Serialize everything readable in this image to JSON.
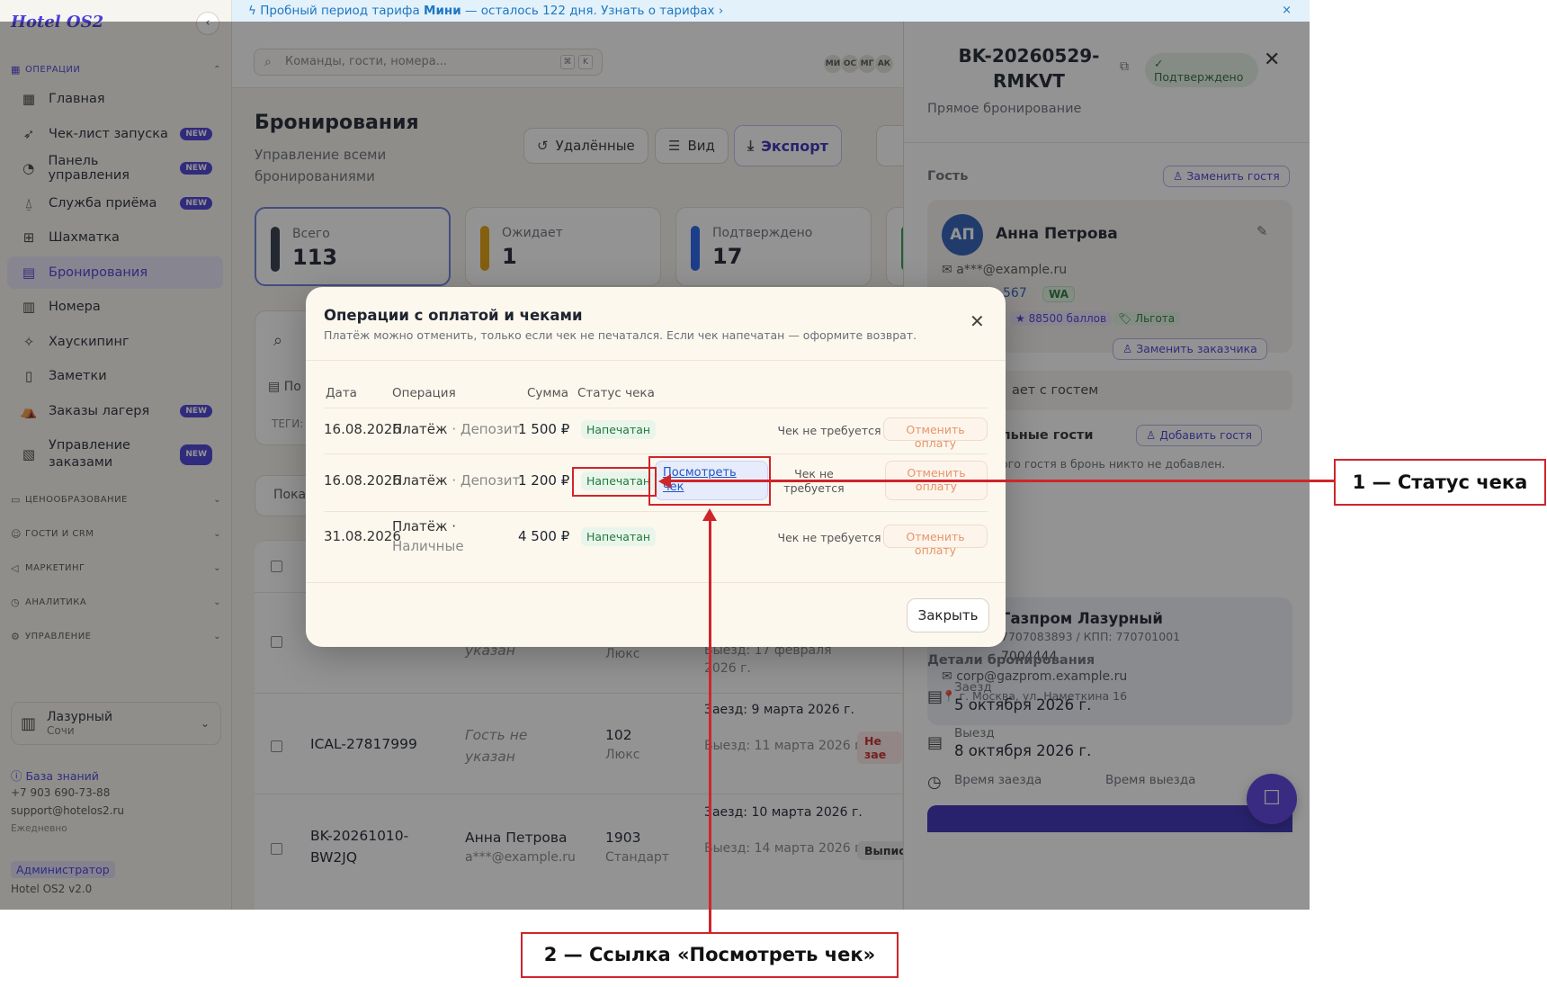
{
  "app": {
    "logo": "Hotel OS2",
    "collapse_glyph": "‹"
  },
  "banner": {
    "prefix": "Пробный период тарифа ",
    "plan": "Мини",
    "suffix": " — осталось 122 дня. Узнать о тарифах",
    "chevron": "›",
    "close": "×"
  },
  "topbar": {
    "search_placeholder": "Команды, гости, номера...",
    "kbd1": "⌘",
    "kbd2": "K",
    "avatars": [
      "МИ",
      "ОС",
      "МГ",
      "АК"
    ]
  },
  "sidebar": {
    "sections": {
      "operations": "Операции",
      "pricing": "Ценообразование",
      "guests": "Гости и CRM",
      "marketing": "Маркетинг",
      "analytics": "Аналитика",
      "management": "Управление"
    },
    "items": [
      {
        "label": "Главная",
        "icon": "grid-icon",
        "new": false
      },
      {
        "label": "Чек-лист запуска",
        "icon": "rocket-icon",
        "new": true
      },
      {
        "label": "Панель управления",
        "icon": "gauge-icon",
        "new": true
      },
      {
        "label": "Служба приёма",
        "icon": "bell-icon",
        "new": true
      },
      {
        "label": "Шахматка",
        "icon": "table-icon",
        "new": false
      },
      {
        "label": "Бронирования",
        "icon": "calendar-icon",
        "new": false
      },
      {
        "label": "Номера",
        "icon": "building-icon",
        "new": false
      },
      {
        "label": "Хаускипинг",
        "icon": "sparkle-icon",
        "new": false
      },
      {
        "label": "Заметки",
        "icon": "note-icon",
        "new": false
      },
      {
        "label": "Заказы лагеря",
        "icon": "tent-icon",
        "new": true
      },
      {
        "label": "Управление заказами",
        "icon": "receipt-icon",
        "new": true
      }
    ],
    "new_badge": "NEW",
    "hotel": {
      "name": "Лазурный",
      "city": "Сочи"
    },
    "kb": "База знаний",
    "phone": "+7 903 690-73-88",
    "email": "support@hotelos2.ru",
    "hours": "Ежедневно",
    "role": "Администратор",
    "version": "Hotel OS2 v2.0"
  },
  "page": {
    "title": "Бронирования",
    "subtitle": "Управление всеми бронированиями",
    "buttons": {
      "deleted": "Удалённые",
      "view": "Вид",
      "export": "Экспорт"
    },
    "stats": [
      {
        "label": "Всего",
        "value": "113",
        "color": "#333a4a"
      },
      {
        "label": "Ожидает",
        "value": "1",
        "color": "#e3a008"
      },
      {
        "label": "Подтверждено",
        "value": "17",
        "color": "#2563eb"
      }
    ],
    "filter_partial": "По",
    "tags_partial": "ТЕГИ:",
    "show_partial": "Пока",
    "rows": [
      {
        "guest": "указан",
        "room": "Люкс",
        "dates": "Выезд: 17 февраля 2026 г."
      },
      {
        "id": "ICAL-27817999",
        "guest": "Гость не указан",
        "room_no": "102",
        "room": "Люкс",
        "checkin": "Заезд: 9 марта 2026 г.",
        "checkout": "Выезд: 11 марта 2026 г.",
        "status": "Не зае"
      },
      {
        "id": "BK-20261010-BW2JQ",
        "guest": "Анна Петрова",
        "email": "a***@example.ru",
        "room_no": "1903",
        "room": "Стандарт",
        "checkin": "Заезд: 10 марта 2026 г.",
        "checkout": "Выезд: 14 марта 2026 г.",
        "status": "Выписа"
      }
    ]
  },
  "panel": {
    "booking_id": "BK-20260529-RMKVT",
    "status": "Подтверждено",
    "source": "Прямое бронирование",
    "guest_section": "Гость",
    "replace_guest": "Заменить гостя",
    "guest": {
      "initials": "АП",
      "name": "Анна Петрова",
      "email": "a***@example.ru",
      "phone_partial": "567",
      "wa": "WA",
      "points": "★ 88500 баллов",
      "benefit": "🏷 Льгота"
    },
    "replace_customer": "Заменить заказчика",
    "customer_partial": "ает с гостем",
    "extra_guests_partial": "льные гости",
    "add_guest": "Добавить гостя",
    "extra_guests_note_partial": "ого гостя в бронь никто не добавлен.",
    "company": {
      "name_partial": "Газпром Лазурный",
      "inn_partial": "7707083893 / КПП: 770701001",
      "phone_partial": "7004444",
      "email": "corp@gazprom.example.ru",
      "address": "📍 г. Москва, ул. Наметкина 16"
    },
    "details": "Детали бронирования",
    "checkin_label": "Заезд",
    "checkin": "5 октября 2026 г.",
    "checkout_label": "Выезд",
    "checkout": "8 октября 2026 г.",
    "checkin_time": "Время заезда",
    "checkout_time": "Время выезда"
  },
  "modal": {
    "title": "Операции с оплатой и чеками",
    "subtitle": "Платёж можно отменить, только если чек не печатался. Если чек напечатан — оформите возврат.",
    "columns": {
      "date": "Дата",
      "op": "Операция",
      "sum": "Сумма",
      "status": "Статус чека"
    },
    "rows": [
      {
        "date": "16.08.2026",
        "op": "Платёж",
        "op_type": "· Депозит",
        "sum": "1 500 ₽",
        "status": "Напечатан",
        "receipt": "Чек не требуется",
        "cancel": "Отменить оплату"
      },
      {
        "date": "16.08.2026",
        "op": "Платёж",
        "op_type": "· Депозит",
        "sum": "1 200 ₽",
        "status": "Напечатан",
        "view": "Посмотреть чек",
        "receipt": "Чек не требуется",
        "cancel": "Отменить оплату"
      },
      {
        "date": "31.08.2026",
        "op": "Платёж ·",
        "op_type": "Наличные",
        "sum": "4 500 ₽",
        "status": "Напечатан",
        "receipt": "Чек не требуется",
        "cancel": "Отменить оплату"
      }
    ],
    "close_btn": "Закрыть"
  },
  "annotations": {
    "callout1": "1 — Статус чека",
    "callout2": "2 — Ссылка «Посмотреть чек»",
    "color": "#d0242b"
  }
}
